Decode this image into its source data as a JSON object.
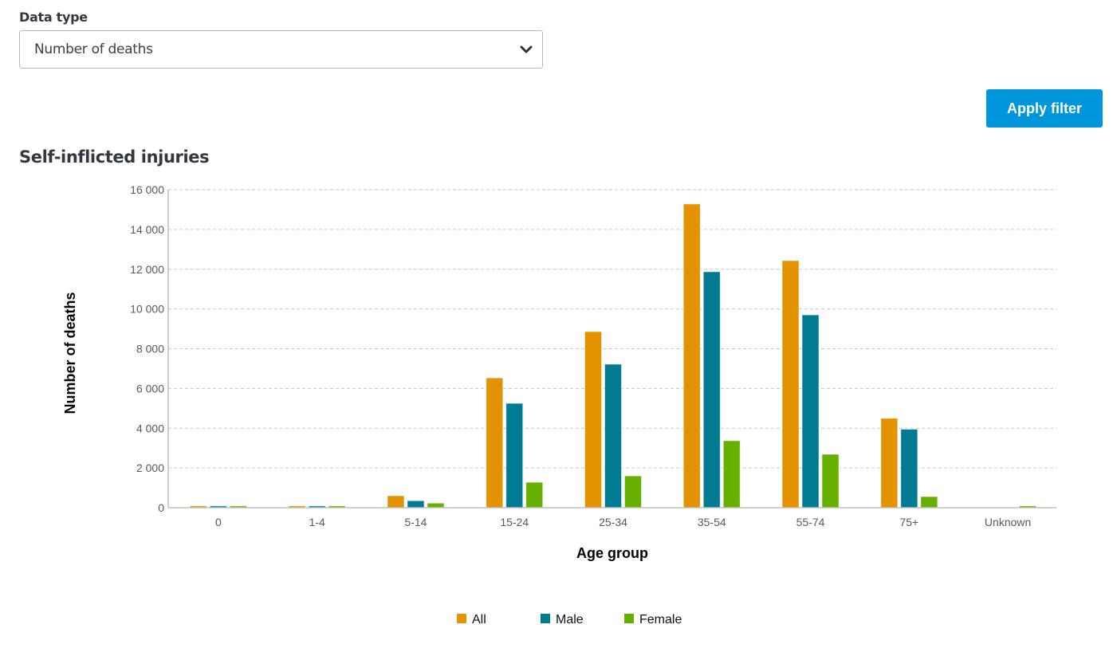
{
  "filter": {
    "label": "Data type",
    "selected": "Number of deaths",
    "chevron_icon": "chevron-down-icon"
  },
  "apply_button": {
    "label": "Apply filter",
    "color": "#0096dc"
  },
  "section": {
    "title": "Self-inflicted injuries"
  },
  "chart_data": {
    "type": "bar",
    "title": "Self-inflicted injuries",
    "xlabel": "Age group",
    "ylabel": "Number of deaths",
    "ylim": [
      0,
      16000
    ],
    "yticks": [
      0,
      2000,
      4000,
      6000,
      8000,
      10000,
      12000,
      14000,
      16000
    ],
    "ytick_labels": [
      "0",
      "2 000",
      "4 000",
      "6 000",
      "8 000",
      "10 000",
      "12 000",
      "14 000",
      "16 000"
    ],
    "grid": "horizontal-dashed",
    "legend_position": "bottom-center",
    "categories": [
      "0",
      "1-4",
      "5-14",
      "15-24",
      "25-34",
      "35-54",
      "55-74",
      "75+",
      "Unknown"
    ],
    "series": [
      {
        "name": "All",
        "color": "#e39300",
        "values": [
          90,
          90,
          600,
          6530,
          8860,
          15280,
          12430,
          4500,
          0
        ]
      },
      {
        "name": "Male",
        "color": "#007b91",
        "values": [
          90,
          90,
          350,
          5250,
          7220,
          11870,
          9700,
          3950,
          0
        ]
      },
      {
        "name": "Female",
        "color": "#66b000",
        "values": [
          90,
          90,
          230,
          1280,
          1600,
          3370,
          2690,
          560,
          90
        ]
      }
    ]
  }
}
